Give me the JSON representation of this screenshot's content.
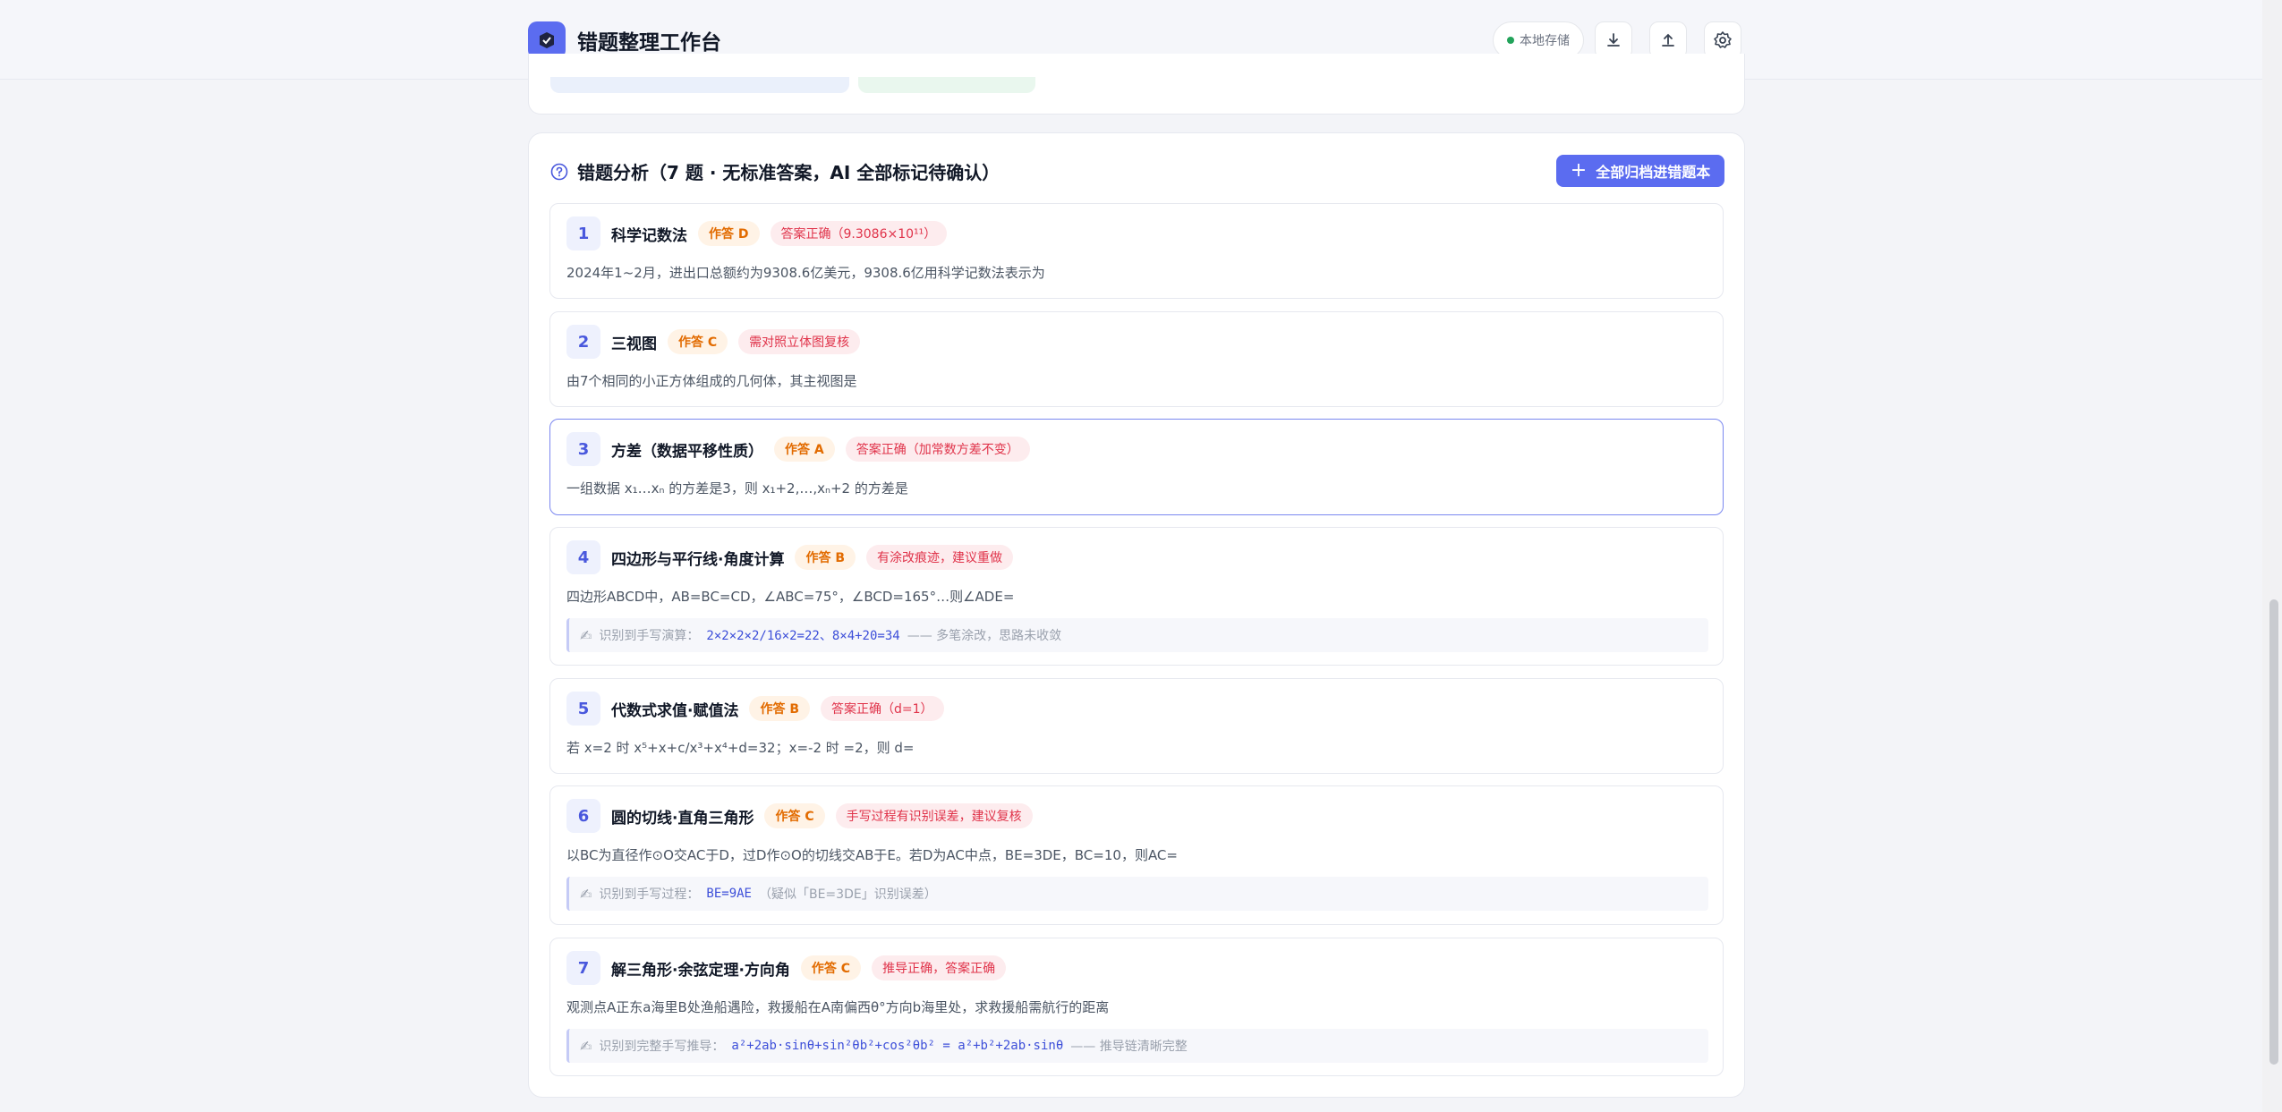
{
  "header": {
    "title": "错题整理工作台",
    "storage_label": "本地存储",
    "icons": [
      "logo-icon",
      "download-icon",
      "upload-icon",
      "settings-icon"
    ]
  },
  "analysis": {
    "title": "错题分析（7 题 · 无标准答案，AI 全部标记待确认）",
    "archive_button": "全部归档进错题本"
  },
  "questions": [
    {
      "num": "1",
      "title": "科学记数法",
      "answer": "作答 D",
      "status": "答案正确（9.3086×10¹¹）",
      "text": "2024年1~2月，进出口总额约为9308.6亿美元，9308.6亿用科学记数法表示为"
    },
    {
      "num": "2",
      "title": "三视图",
      "answer": "作答 C",
      "status": "需对照立体图复核",
      "text": "由7个相同的小正方体组成的几何体，其主视图是"
    },
    {
      "num": "3",
      "title": "方差（数据平移性质）",
      "answer": "作答 A",
      "status": "答案正确（加常数方差不变）",
      "text": "一组数据 x₁…xₙ 的方差是3，则 x₁+2,…,xₙ+2 的方差是"
    },
    {
      "num": "4",
      "title": "四边形与平行线·角度计算",
      "answer": "作答 B",
      "status": "有涂改痕迹，建议重做",
      "text": "四边形ABCD中，AB=BC=CD，∠ABC=75°，∠BCD=165°…则∠ADE=",
      "hw_prefix": "识别到手写演算：",
      "hw_code": "2×2×2×2/16×2=22、8×4+20=34",
      "hw_suffix": "—— 多笔涂改，思路未收敛"
    },
    {
      "num": "5",
      "title": "代数式求值·赋值法",
      "answer": "作答 B",
      "status": "答案正确（d=1）",
      "text": "若 x=2 时 x⁵+x+c/x³+x⁴+d=32；x=-2 时 =2，则 d="
    },
    {
      "num": "6",
      "title": "圆的切线·直角三角形",
      "answer": "作答 C",
      "status": "手写过程有识别误差，建议复核",
      "text": "以BC为直径作⊙O交AC于D，过D作⊙O的切线交AB于E。若D为AC中点，BE=3DE，BC=10，则AC=",
      "hw_prefix": "识别到手写过程：",
      "hw_code": "BE=9AE",
      "hw_suffix": "（疑似「BE=3DE」识别误差）"
    },
    {
      "num": "7",
      "title": "解三角形·余弦定理·方向角",
      "answer": "作答 C",
      "status": "推导正确，答案正确",
      "text": "观测点A正东a海里B处渔船遇险，救援船在A南偏西θ°方向b海里处，求救援船需航行的距离",
      "hw_prefix": "识别到完整手写推导：",
      "hw_code": "a²+2ab·sinθ+sin²θb²+cos²θb² = a²+b²+2ab·sinθ",
      "hw_suffix": "—— 推导链清晰完整"
    }
  ],
  "colors": {
    "accent": "#5b6cf0",
    "answer_tag_bg": "#fff3e6",
    "answer_tag_text": "#e26b00",
    "status_tag_bg": "#fdecee",
    "status_tag_text": "#e0334a"
  }
}
